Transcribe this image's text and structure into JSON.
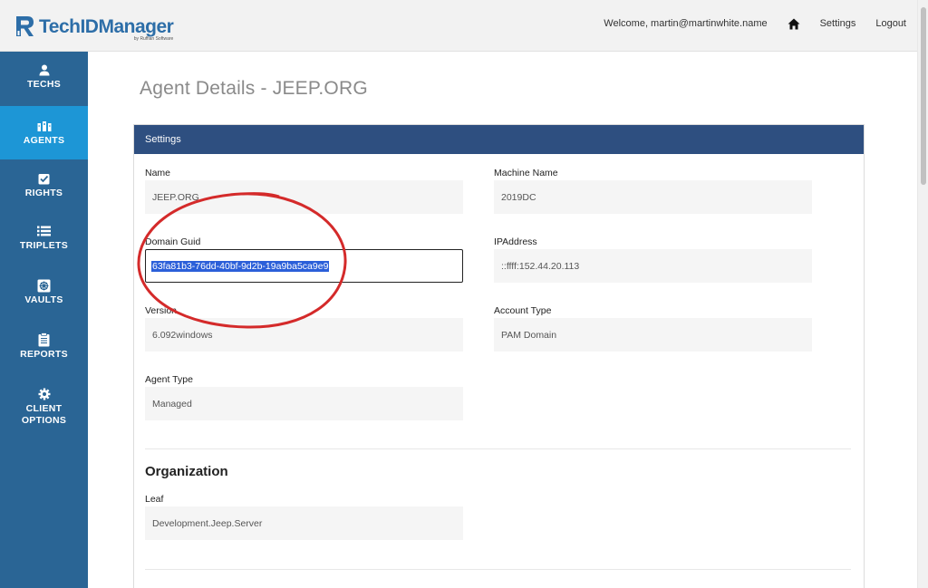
{
  "app": {
    "logo_prefix": "Tech",
    "logo_id": "ID",
    "logo_suffix": "Manager",
    "logo_sub": "by Ruffian Software"
  },
  "topnav": {
    "welcome": "Welcome, martin@martinwhite.name",
    "settings": "Settings",
    "logout": "Logout"
  },
  "sidebar": {
    "items": [
      {
        "label": "TECHS",
        "icon": "user-icon"
      },
      {
        "label": "AGENTS",
        "icon": "agents-icon",
        "active": true
      },
      {
        "label": "RIGHTS",
        "icon": "checkbox-icon"
      },
      {
        "label": "TRIPLETS",
        "icon": "list-icon"
      },
      {
        "label": "VAULTS",
        "icon": "vault-icon"
      },
      {
        "label": "REPORTS",
        "icon": "clipboard-icon"
      },
      {
        "label": "CLIENT",
        "label2": "OPTIONS",
        "icon": "gear-icon"
      }
    ]
  },
  "page": {
    "title": "Agent Details - JEEP.ORG"
  },
  "settings": {
    "header": "Settings",
    "name_label": "Name",
    "name_value": "JEEP.ORG",
    "machine_label": "Machine Name",
    "machine_value": "2019DC",
    "guid_label": "Domain Guid",
    "guid_value": "63fa81b3-76dd-40bf-9d2b-19a9ba5ca9e9",
    "ip_label": "IPAddress",
    "ip_value": "::ffff:152.44.20.113",
    "version_label": "Version",
    "version_value": "6.092windows",
    "account_label": "Account Type",
    "account_value": "PAM Domain",
    "agent_type_label": "Agent Type",
    "agent_type_value": "Managed"
  },
  "organization": {
    "title": "Organization",
    "leaf_label": "Leaf",
    "leaf_value": "Development.Jeep.Server"
  },
  "colors": {
    "sidebar": "#2a6595",
    "sidebar_active": "#1d96d6",
    "panel_header": "#2e4f80",
    "annotation": "#d42a2a"
  }
}
